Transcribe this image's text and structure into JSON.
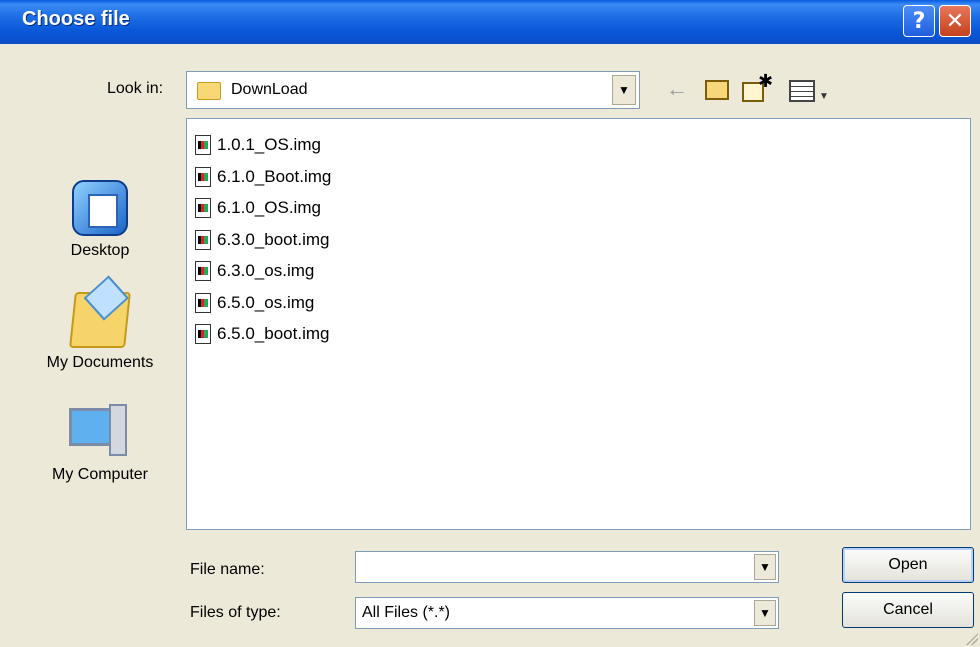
{
  "window": {
    "title": "Choose file",
    "help_glyph": "?",
    "close_glyph": "✕"
  },
  "look_in": {
    "label": "Look in:",
    "value": "DownLoad"
  },
  "places": [
    {
      "label": "Desktop"
    },
    {
      "label": "My Documents"
    },
    {
      "label": "My Computer"
    }
  ],
  "files": [
    "1.0.1_OS.img",
    "6.1.0_Boot.img",
    "6.1.0_OS.img",
    "6.3.0_boot.img",
    "6.3.0_os.img",
    "6.5.0_os.img",
    "6.5.0_boot.img"
  ],
  "file_name": {
    "label": "File name:",
    "value": ""
  },
  "file_type": {
    "label": "Files of type:",
    "value": "All Files (*.*)"
  },
  "buttons": {
    "open": "Open",
    "cancel": "Cancel"
  },
  "icons": {
    "back": "back-arrow-icon",
    "up": "up-one-level-icon",
    "new_folder": "new-folder-icon",
    "view_menu": "view-menu-icon"
  },
  "colors": {
    "titlebar": "#0a58d8",
    "dialog_bg": "#ece9d8",
    "close_button": "#c4411e"
  }
}
